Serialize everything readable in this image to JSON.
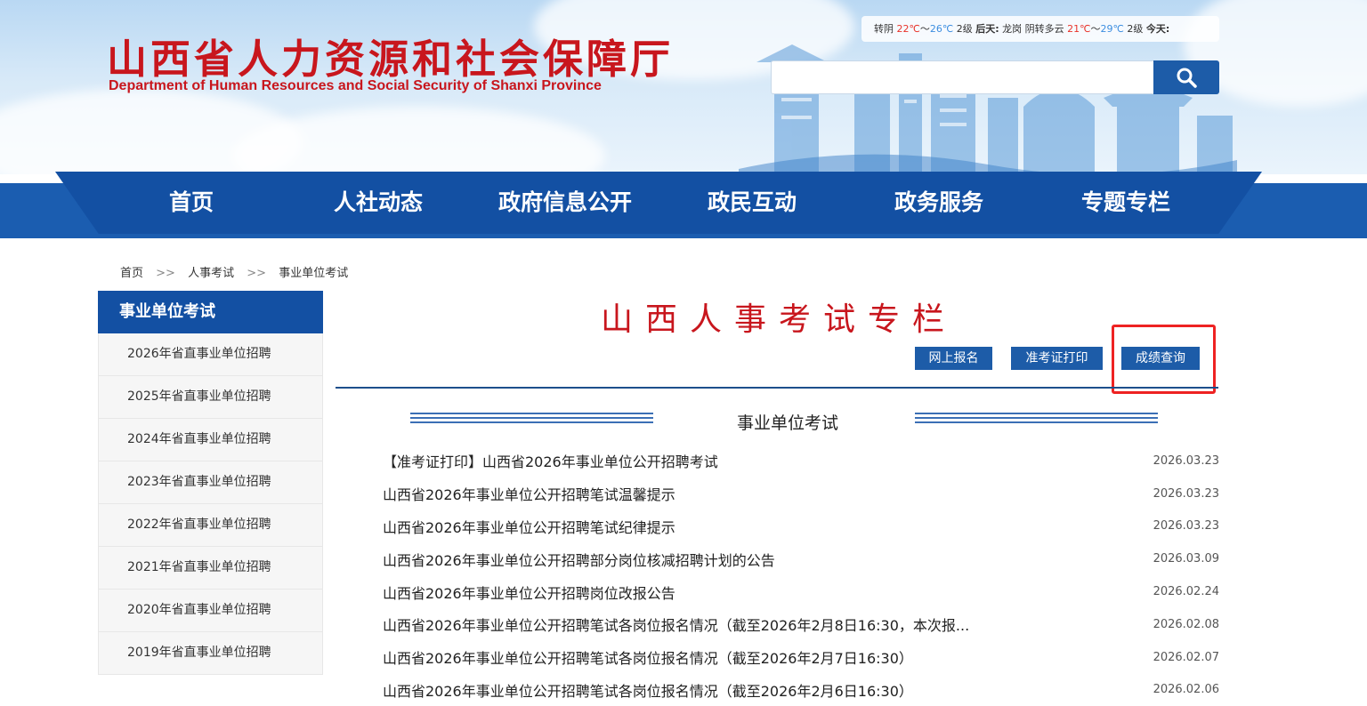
{
  "site": {
    "title_cn": "山西省人力资源和社会保障厅",
    "title_en": "Department of Human Resources and Social Security of Shanxi Province"
  },
  "weather": {
    "part1": "转阴",
    "today_temp_low": "22℃",
    "sep1": "～",
    "today_temp_high": "26℃",
    "wind1": "2级",
    "label_after": "后天:",
    "city": "龙岗",
    "weather2": "阴转多云",
    "temp2_low": "21℃",
    "sep2": "～",
    "temp2_high": "29℃",
    "wind2": "2级",
    "label_today": "今天:"
  },
  "search": {
    "placeholder": ""
  },
  "nav": [
    "首页",
    "人社动态",
    "政府信息公开",
    "政民互动",
    "政务服务",
    "专题专栏"
  ],
  "breadcrumb": [
    "首页",
    "人事考试",
    "事业单位考试"
  ],
  "breadcrumb_sep": ">>",
  "sidebar": {
    "title": "事业单位考试",
    "items": [
      "2026年省直事业单位招聘",
      "2025年省直事业单位招聘",
      "2024年省直事业单位招聘",
      "2023年省直事业单位招聘",
      "2022年省直事业单位招聘",
      "2021年省直事业单位招聘",
      "2020年省直事业单位招聘",
      "2019年省直事业单位招聘"
    ]
  },
  "main": {
    "title": "山西人事考试专栏",
    "buttons": [
      "网上报名",
      "准考证打印",
      "成绩查询"
    ],
    "section_title": "事业单位考试",
    "news": [
      {
        "title": "【准考证打印】山西省2026年事业单位公开招聘考试",
        "date": "2026.03.23"
      },
      {
        "title": "山西省2026年事业单位公开招聘笔试温馨提示",
        "date": "2026.03.23"
      },
      {
        "title": "山西省2026年事业单位公开招聘笔试纪律提示",
        "date": "2026.03.23"
      },
      {
        "title": "山西省2026年事业单位公开招聘部分岗位核减招聘计划的公告",
        "date": "2026.03.09"
      },
      {
        "title": "山西省2026年事业单位公开招聘岗位改报公告",
        "date": "2026.02.24"
      },
      {
        "title": "山西省2026年事业单位公开招聘笔试各岗位报名情况（截至2026年2月8日16:30，本次报...",
        "date": "2026.02.08"
      },
      {
        "title": "山西省2026年事业单位公开招聘笔试各岗位报名情况（截至2026年2月7日16:30）",
        "date": "2026.02.07"
      },
      {
        "title": "山西省2026年事业单位公开招聘笔试各岗位报名情况（截至2026年2月6日16:30）",
        "date": "2026.02.06"
      }
    ]
  },
  "colors": {
    "brand_blue": "#1350a3",
    "brand_red": "#c8161d",
    "highlight": "#ee2222"
  }
}
